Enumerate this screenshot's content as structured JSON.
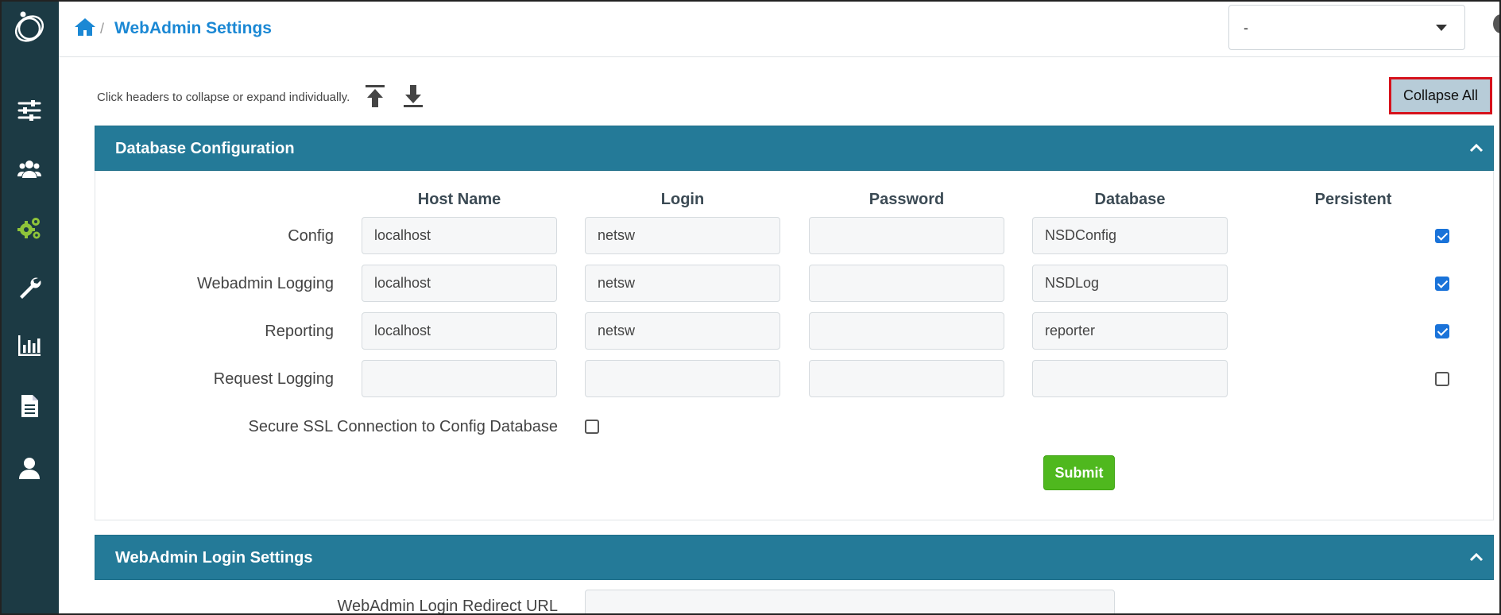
{
  "header": {
    "breadcrumb_sep": "/",
    "title": "WebAdmin Settings",
    "select_value": "-"
  },
  "sidebar": {
    "items": [
      {
        "name": "sliders-icon"
      },
      {
        "name": "users-icon"
      },
      {
        "name": "gears-icon",
        "active": true
      },
      {
        "name": "wrench-icon"
      },
      {
        "name": "bar-chart-icon"
      },
      {
        "name": "document-icon"
      },
      {
        "name": "user-icon"
      }
    ]
  },
  "toolbar": {
    "hint": "Click headers to collapse or expand individually.",
    "collapse_all_label": "Collapse All"
  },
  "db_panel": {
    "title": "Database Configuration",
    "columns": [
      "Host Name",
      "Login",
      "Password",
      "Database",
      "Persistent"
    ],
    "rows": [
      {
        "label": "Config",
        "host": "localhost",
        "login": "netsw",
        "password": "",
        "database": "NSDConfig",
        "persistent": true
      },
      {
        "label": "Webadmin Logging",
        "host": "localhost",
        "login": "netsw",
        "password": "",
        "database": "NSDLog",
        "persistent": true
      },
      {
        "label": "Reporting",
        "host": "localhost",
        "login": "netsw",
        "password": "",
        "database": "reporter",
        "persistent": true
      },
      {
        "label": "Request Logging",
        "host": "",
        "login": "",
        "password": "",
        "database": "",
        "persistent": false
      }
    ],
    "ssl_label": "Secure SSL Connection to Config Database",
    "ssl_checked": false,
    "submit_label": "Submit"
  },
  "login_panel": {
    "title": "WebAdmin Login Settings",
    "redirect_label": "WebAdmin Login Redirect URL"
  },
  "colors": {
    "sidebar": "#1c3a44",
    "panel_header": "#247a98",
    "accent_link": "#1b88d4",
    "submit": "#4fb81e",
    "active_icon": "#8fc43a",
    "highlight": "#d6121c"
  }
}
